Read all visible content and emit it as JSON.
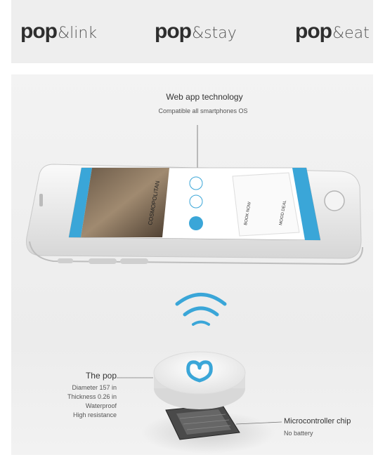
{
  "nav": {
    "logos": [
      {
        "brand": "pop",
        "suffix": "&link"
      },
      {
        "brand": "pop",
        "suffix": "&stay"
      },
      {
        "brand": "pop",
        "suffix": "&eat"
      }
    ]
  },
  "technology": {
    "title": "Web app technology",
    "subtitle": "Compatible all smartphones OS"
  },
  "pop": {
    "title": "The pop",
    "specs": [
      "Diameter 157 in",
      "Thickness 0.26 in",
      "Waterproof",
      "High resistance"
    ]
  },
  "chip": {
    "title": "Microcontroller chip",
    "subtitle": "No battery"
  },
  "phone_screen": {
    "hotel_name": "COSMOPOLITAN",
    "card_title_1": "BOOK NOW",
    "card_title_2": "MOOD DEAL"
  },
  "colors": {
    "accent_blue": "#3aa6d8",
    "header_bg": "#eeeeee",
    "panel_bg": "#f0f0f0"
  }
}
